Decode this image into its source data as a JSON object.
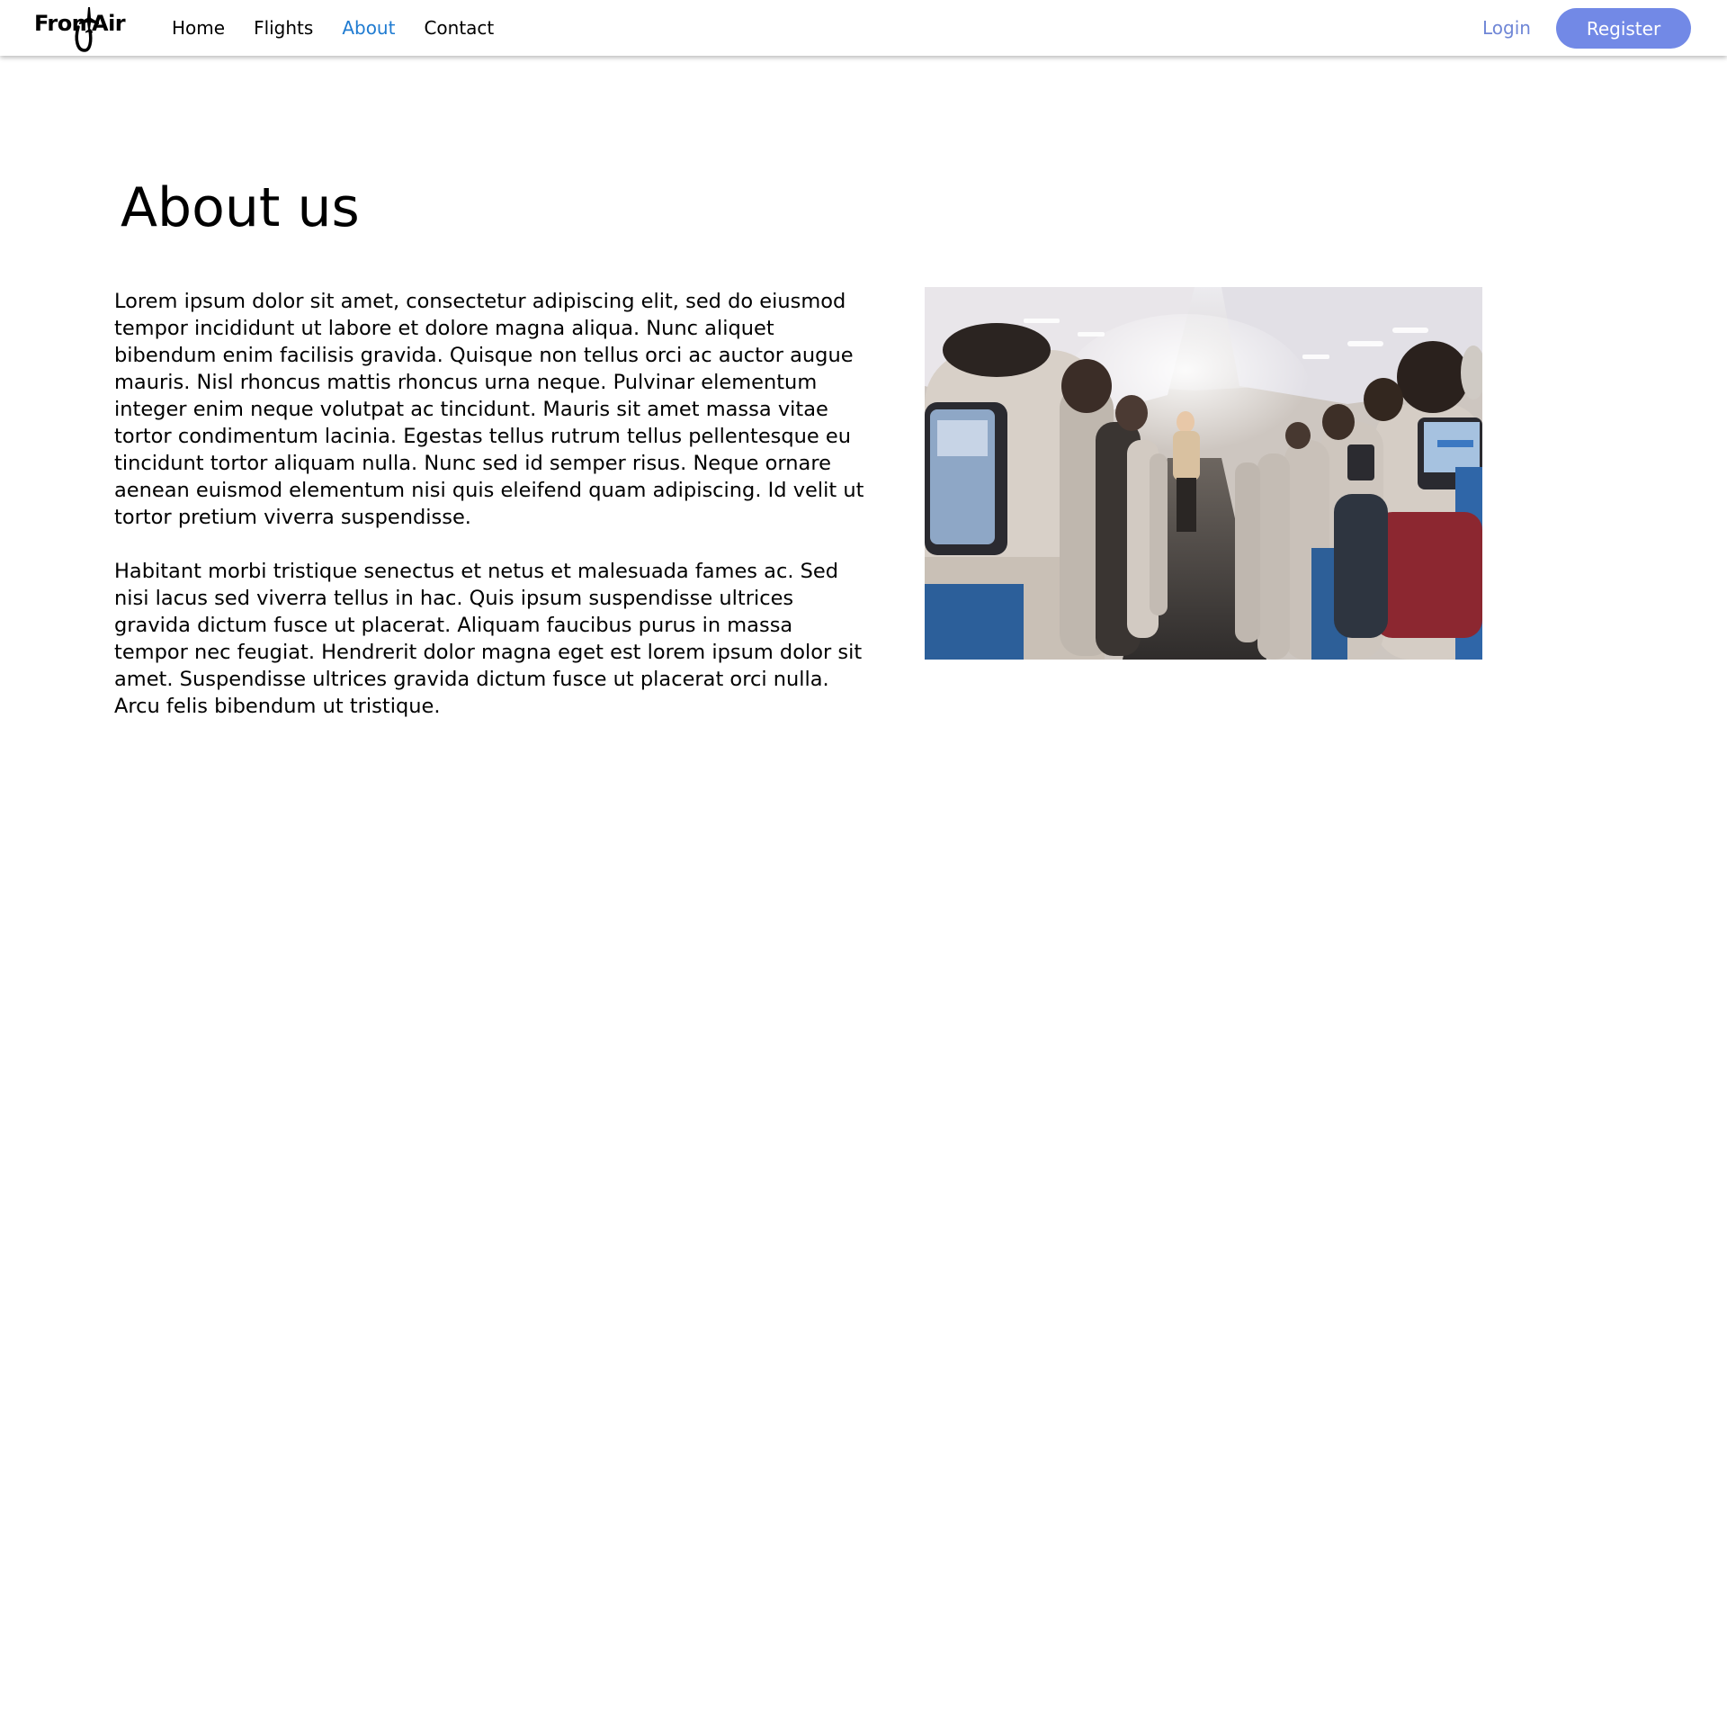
{
  "nav": {
    "logo_left": "Fron",
    "logo_right": "Air",
    "logo_icon": "airplane-icon",
    "links": [
      {
        "label": "Home",
        "active": false
      },
      {
        "label": "Flights",
        "active": false
      },
      {
        "label": "About",
        "active": true
      },
      {
        "label": "Contact",
        "active": false
      }
    ],
    "login_label": "Login",
    "register_label": "Register"
  },
  "main": {
    "title": "About us",
    "paragraphs": [
      "Lorem ipsum dolor sit amet, consectetur adipiscing elit, sed do  eiusmod\ntempor incididunt ut labore et dolore magna aliqua. Nunc aliquet\nbibendum enim facilisis gravida. Quisque non tellus orci ac auctor  augue\nmauris. Nisl rhoncus mattis rhoncus urna neque. Pulvinar elementum\ninteger enim neque volutpat ac tincidunt. Mauris sit amet massa vitae\ntortor condimentum lacinia. Egestas tellus rutrum tellus pellentesque eu\ntincidunt tortor aliquam nulla. Nunc sed id semper risus. Neque ornare\naenean euismod elementum nisi quis eleifend quam adipiscing. Id velit ut\ntortor pretium viverra suspendisse.",
      "Habitant morbi tristique senectus et netus et malesuada fames ac. Sed\nnisi lacus sed viverra tellus in hac. Quis ipsum suspendisse ultrices\ngravida dictum fusce ut placerat. Aliquam faucibus purus in massa\ntempor  nec feugiat. Hendrerit dolor magna eget est lorem ipsum dolor sit\namet.  Suspendisse ultrices gravida dictum fusce ut placerat orci nulla.\nArcu  felis bibendum ut tristique."
    ]
  },
  "colors": {
    "active_link": "#1f7bd1",
    "login": "#6f86d6",
    "register_bg": "#7289e6",
    "register_text": "#ffffff"
  }
}
